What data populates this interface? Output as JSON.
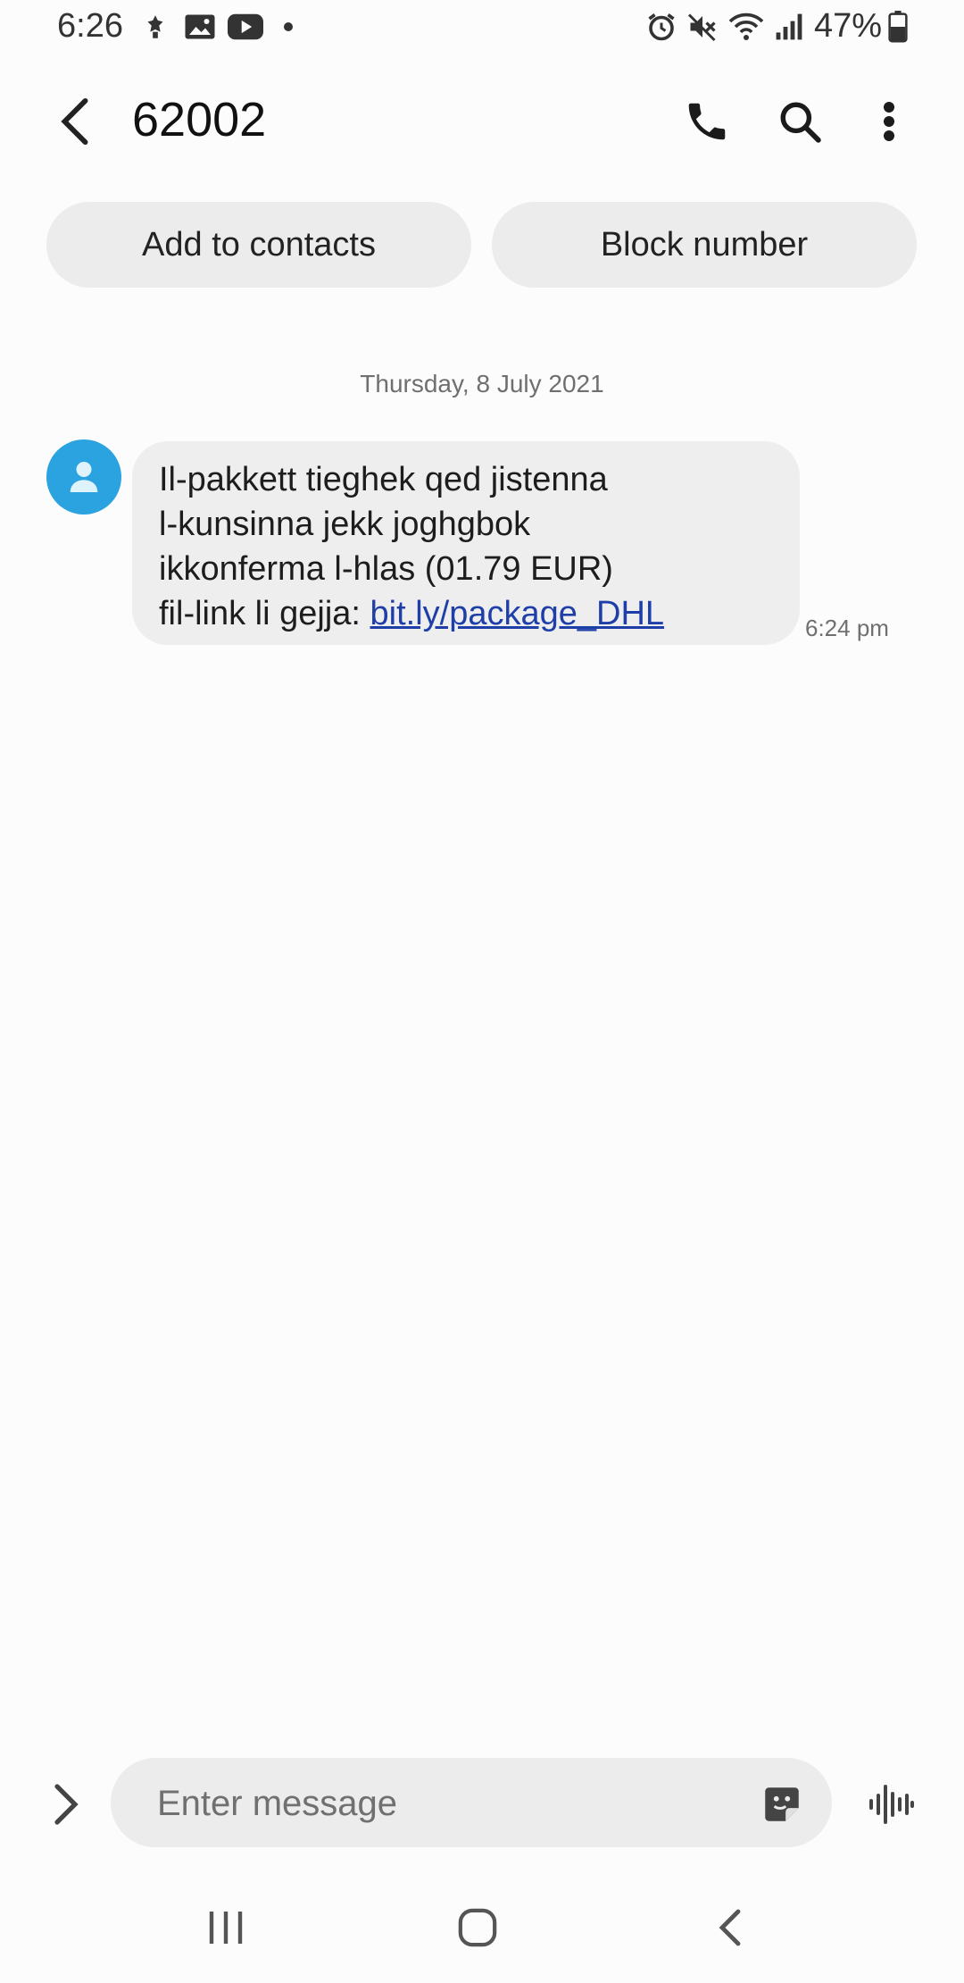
{
  "status_bar": {
    "time": "6:26",
    "battery": "47%",
    "icons": [
      "bixby-routine-icon",
      "gallery-icon",
      "youtube-icon",
      "dot-icon",
      "alarm-icon",
      "mute-icon",
      "wifi-icon",
      "signal-icon",
      "battery-icon"
    ]
  },
  "header": {
    "title": "62002",
    "icons": [
      "back-arrow-icon",
      "phone-icon",
      "search-icon",
      "more-vertical-icon"
    ]
  },
  "actions": {
    "add_contacts": "Add to contacts",
    "block_number": "Block number"
  },
  "conversation": {
    "date": "Thursday, 8 July 2021",
    "messages": [
      {
        "lines": [
          "Il-pakkett tieghek qed jistenna",
          "l-kunsinna jekk joghgbok",
          "ikkonferma l-hlas (01.79 EUR)",
          "fil-link li gejja: "
        ],
        "link": "bit.ly/package_DHL",
        "time": "6:24 pm"
      }
    ]
  },
  "composer": {
    "placeholder": "Enter message"
  },
  "colors": {
    "avatar": "#2aa3e0",
    "link": "#1e3fa8",
    "bubble": "#eeeeee",
    "pill": "#ececec"
  }
}
